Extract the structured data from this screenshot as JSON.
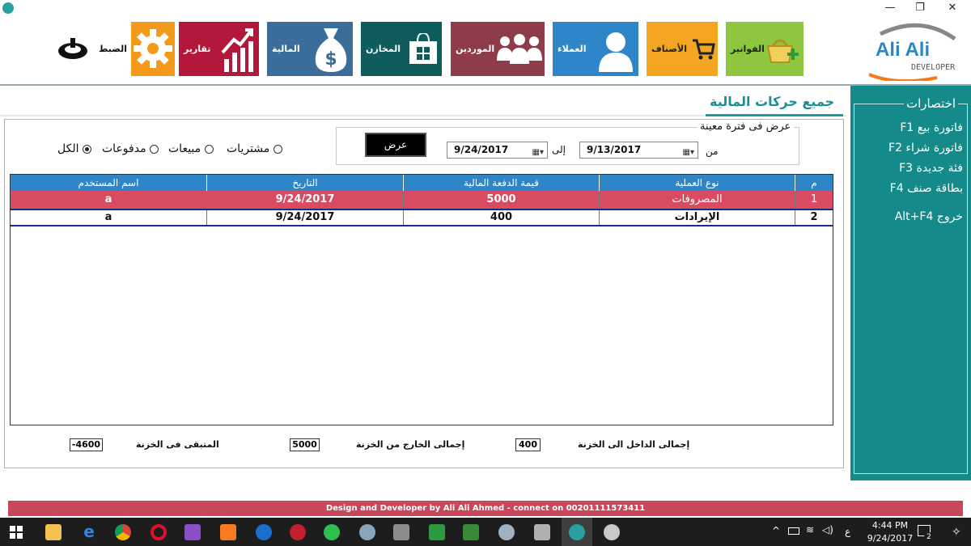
{
  "window": {
    "minimize": "—",
    "restore": "❐",
    "close": "✕"
  },
  "brand": {
    "line1": "Ali Ali",
    "line2": "DEVELOPER",
    "color": "#2e86c8"
  },
  "toolbar": [
    {
      "id": "invoices",
      "label": "الفواتير",
      "color": "#8dc63f",
      "icon": "basket-add-icon"
    },
    {
      "id": "items",
      "label": "الأصناف",
      "color": "#f4a623",
      "icon": "cart-icon"
    },
    {
      "id": "customers",
      "label": "العملاء",
      "color": "#2e86c8",
      "icon": "person-icon"
    },
    {
      "id": "suppliers",
      "label": "الموردين",
      "color": "#8e3b4a",
      "icon": "group-icon"
    },
    {
      "id": "stores",
      "label": "المخازن",
      "color": "#0f5c5c",
      "icon": "store-icon"
    },
    {
      "id": "finance",
      "label": "المالية",
      "color": "#3a6d99",
      "icon": "money-bag-icon"
    },
    {
      "id": "reports",
      "label": "تقارير",
      "color": "#b3173a",
      "icon": "chart-up-icon"
    },
    {
      "id": "settings",
      "label": "الضبط",
      "color": "#f49a1a",
      "icon": "gear-icon"
    }
  ],
  "section_title": "جميع حركات المالية",
  "filters": {
    "options": [
      "مشتريات",
      "مبيعات",
      "مدفوعات",
      "الكل"
    ],
    "selected": "الكل"
  },
  "period": {
    "legend": "عرض فى فترة معينة",
    "from_label": "من",
    "to_label": "إلى",
    "from_date": "9/13/2017",
    "to_date": "9/24/2017",
    "show_button": "عرض"
  },
  "grid": {
    "headers": [
      "م",
      "نوع العملية",
      "قيمة الدفعة المالية",
      "التاريخ",
      "اسم المستخدم"
    ],
    "rows": [
      [
        "1",
        "المصروفات",
        "5000",
        "9/24/2017",
        "a"
      ],
      [
        "2",
        "الإيرادات",
        "400",
        "9/24/2017",
        "a"
      ]
    ]
  },
  "totals": {
    "in_label": "إجمالى الداخل الى الخزنة",
    "in_value": "400",
    "out_label": "إجمالى الخارج من الخزنة",
    "out_value": "5000",
    "remaining_label": "المتبقى فى الخزنة",
    "remaining_value": "-4600"
  },
  "shortcuts": {
    "title": "اختصارات",
    "items": [
      "فاتورة بيع  F1",
      "فاتورة شراء  F2",
      "فئة جديدة  F3",
      "بطاقة صنف  F4",
      "خروج  Alt+F4"
    ]
  },
  "footer": "Design and Developer by Ali Ali Ahmed - connect on 00201111573411",
  "taskbar": {
    "time": "4:44 PM",
    "date": "9/24/2017",
    "lang": "ع",
    "notif": "2"
  }
}
